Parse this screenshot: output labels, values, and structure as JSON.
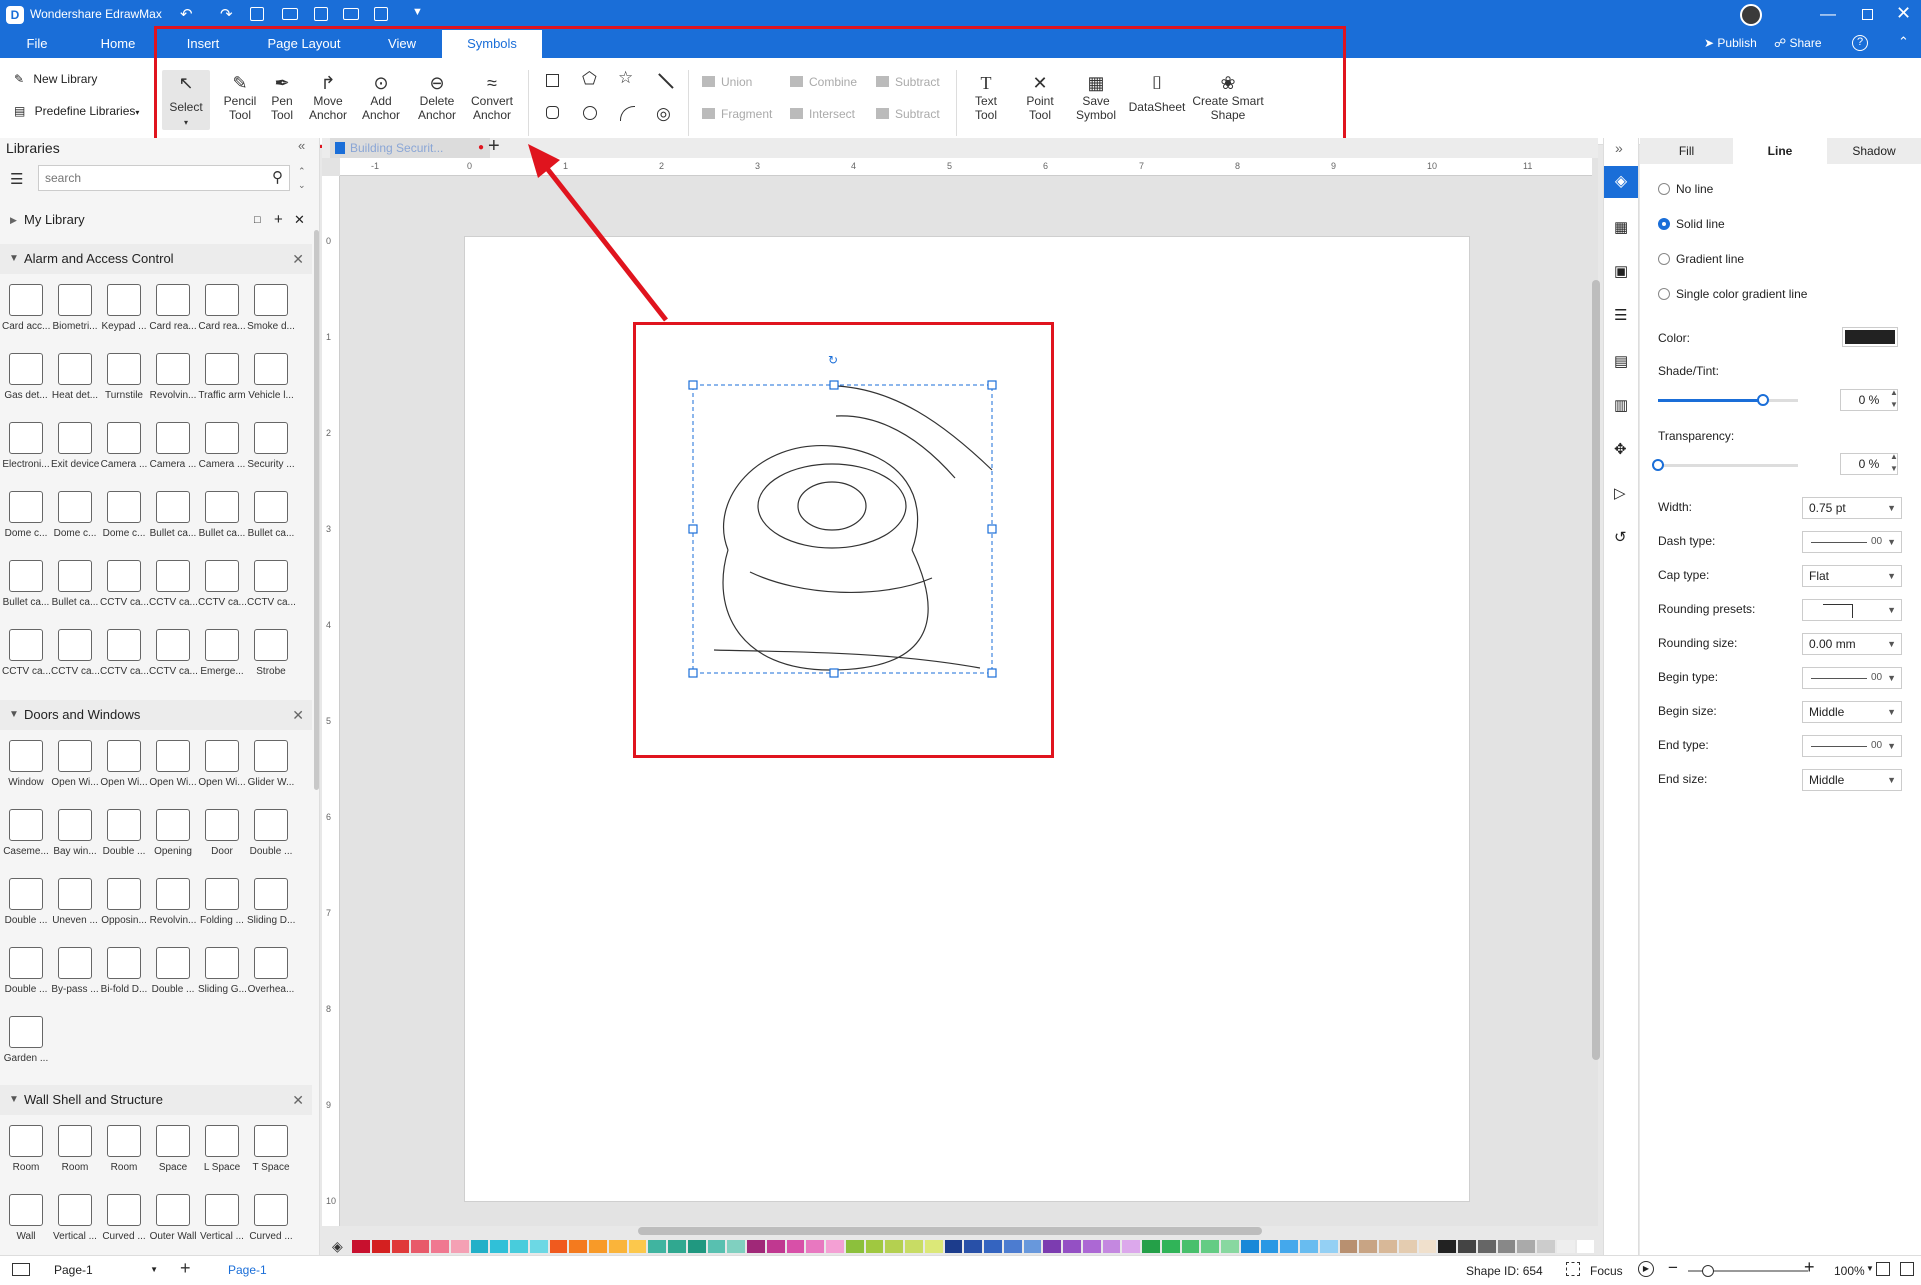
{
  "app": {
    "title": "Wondershare EdrawMax",
    "window_controls": [
      "minimize-icon",
      "maximize-icon",
      "close-icon"
    ]
  },
  "menu": {
    "items": [
      "File",
      "Home",
      "Insert",
      "Page Layout",
      "View",
      "Symbols"
    ],
    "active": "Symbols",
    "publish": "Publish",
    "share": "Share"
  },
  "ribbon": {
    "tools": [
      {
        "label": "Select",
        "icon": "pointer-icon"
      },
      {
        "label": "Pencil Tool",
        "icon": "pencil-icon"
      },
      {
        "label": "Pen Tool",
        "icon": "pen-icon"
      },
      {
        "label": "Move Anchor",
        "icon": "move-anchor-icon"
      },
      {
        "label": "Add Anchor",
        "icon": "add-anchor-icon"
      },
      {
        "label": "Delete Anchor",
        "icon": "delete-anchor-icon"
      },
      {
        "label": "Convert Anchor",
        "icon": "convert-anchor-icon"
      }
    ],
    "shapes": [
      "rectangle",
      "pentagon",
      "star",
      "line",
      "rounded-rectangle",
      "circle",
      "arc",
      "spiral"
    ],
    "boolean_ops": [
      "Union",
      "Combine",
      "Subtract",
      "Fragment",
      "Intersect",
      "Subtract"
    ],
    "actions": [
      {
        "label": "Text Tool",
        "icon": "text-icon"
      },
      {
        "label": "Point Tool",
        "icon": "point-icon"
      },
      {
        "label": "Save Symbol",
        "icon": "save-icon"
      },
      {
        "label": "DataSheet",
        "icon": "database-icon"
      },
      {
        "label": "Create Smart Shape",
        "icon": "smart-shape-icon"
      }
    ]
  },
  "left": {
    "new_library": "New Library",
    "predefine": "Predefine Libraries",
    "libraries_title": "Libraries",
    "search_placeholder": "search",
    "my_library": "My Library",
    "sections": [
      {
        "title": "Alarm and Access Control",
        "items": [
          "Card acc...",
          "Biometri...",
          "Keypad ...",
          "Card rea...",
          "Card rea...",
          "Smoke d...",
          "Gas det...",
          "Heat det...",
          "Turnstile",
          "Revolvin...",
          "Traffic arm",
          "Vehicle l...",
          "Electroni...",
          "Exit device",
          "Camera ...",
          "Camera ...",
          "Camera ...",
          "Security ...",
          "Dome c...",
          "Dome c...",
          "Dome c...",
          "Bullet ca...",
          "Bullet ca...",
          "Bullet ca...",
          "Bullet ca...",
          "Bullet ca...",
          "CCTV ca...",
          "CCTV ca...",
          "CCTV ca...",
          "CCTV ca...",
          "CCTV ca...",
          "CCTV ca...",
          "CCTV ca...",
          "CCTV ca...",
          "Emerge...",
          "Strobe"
        ]
      },
      {
        "title": "Doors and Windows",
        "items": [
          "Window",
          "Open Wi...",
          "Open Wi...",
          "Open Wi...",
          "Open Wi...",
          "Glider W...",
          "Caseme...",
          "Bay win...",
          "Double ...",
          "Opening",
          "Door",
          "Double ...",
          "Double ...",
          "Uneven ...",
          "Opposin...",
          "Revolvin...",
          "Folding ...",
          "Sliding D...",
          "Double ...",
          "By-pass ...",
          "Bi-fold D...",
          "Double ...",
          "Sliding G...",
          "Overhea...",
          "Garden ..."
        ]
      },
      {
        "title": "Wall Shell and Structure",
        "items": [
          "Room",
          "Room",
          "Room",
          "Space",
          "L Space",
          "T Space",
          "Wall",
          "Vertical ...",
          "Curved ...",
          "Outer Wall",
          "Vertical ...",
          "Curved ..."
        ]
      }
    ]
  },
  "canvas": {
    "tab_label": "Building Securit...",
    "ruler_h": [
      "-1",
      "0",
      "1",
      "2",
      "3",
      "4",
      "5",
      "6",
      "7",
      "8",
      "9",
      "10",
      "11"
    ],
    "ruler_v": [
      "0",
      "1",
      "2",
      "3",
      "4",
      "5",
      "6",
      "7",
      "8",
      "9",
      "10"
    ]
  },
  "right": {
    "tabs": [
      "Fill",
      "Line",
      "Shadow"
    ],
    "active_tab": "Line",
    "line_options": [
      "No line",
      "Solid line",
      "Gradient line",
      "Single color gradient line"
    ],
    "selected_option": "Solid line",
    "color_label": "Color:",
    "color_value": "#222222",
    "shade_label": "Shade/Tint:",
    "shade_value": "0 %",
    "shade_level": 0.75,
    "transparency_label": "Transparency:",
    "transparency_value": "0 %",
    "transparency_level": 0.0,
    "fields": [
      {
        "label": "Width:",
        "value": "0.75 pt"
      },
      {
        "label": "Dash type:",
        "value": "00"
      },
      {
        "label": "Cap type:",
        "value": "Flat"
      },
      {
        "label": "Rounding presets:",
        "value": ""
      },
      {
        "label": "Rounding size:",
        "value": "0.00 mm"
      },
      {
        "label": "Begin type:",
        "value": "00"
      },
      {
        "label": "Begin size:",
        "value": "Middle"
      },
      {
        "label": "End type:",
        "value": "00"
      },
      {
        "label": "End size:",
        "value": "Middle"
      }
    ]
  },
  "status": {
    "page_select": "Page-1",
    "page_tab": "Page-1",
    "shape_id": "Shape ID: 654",
    "focus": "Focus",
    "zoom": "100%"
  },
  "palette": [
    "#c8102e",
    "#d42020",
    "#e03a3a",
    "#e85a6a",
    "#f07890",
    "#f4a0b4",
    "#22b0c8",
    "#30c0d8",
    "#48ccdc",
    "#6cd8e4",
    "#f05a1e",
    "#f47a1e",
    "#f89a28",
    "#fab43a",
    "#fcc84c",
    "#40b4a0",
    "#30a890",
    "#209880",
    "#58c0b0",
    "#80d0c0",
    "#a02878",
    "#c03890",
    "#d850a8",
    "#e878c0",
    "#f4a0d4",
    "#8cc03c",
    "#a0c840",
    "#b4d050",
    "#c8dc64",
    "#dce878",
    "#1c3c8c",
    "#2850a8",
    "#3464c0",
    "#4c7cd0",
    "#6898dc",
    "#7c3cb0",
    "#9450c4",
    "#ac68d4",
    "#c488e0",
    "#dca8ec",
    "#24a048",
    "#30b458",
    "#48c06c",
    "#64cc84",
    "#88d8a0",
    "#1888d8",
    "#2898e4",
    "#44a8ec",
    "#68bcf0",
    "#94d0f4",
    "#b89070",
    "#c8a484",
    "#d8b898",
    "#e4ccb0",
    "#f0e0cc",
    "#222222",
    "#444444",
    "#666666",
    "#888888",
    "#aaaaaa",
    "#cccccc",
    "#eeeeee",
    "#ffffff"
  ]
}
